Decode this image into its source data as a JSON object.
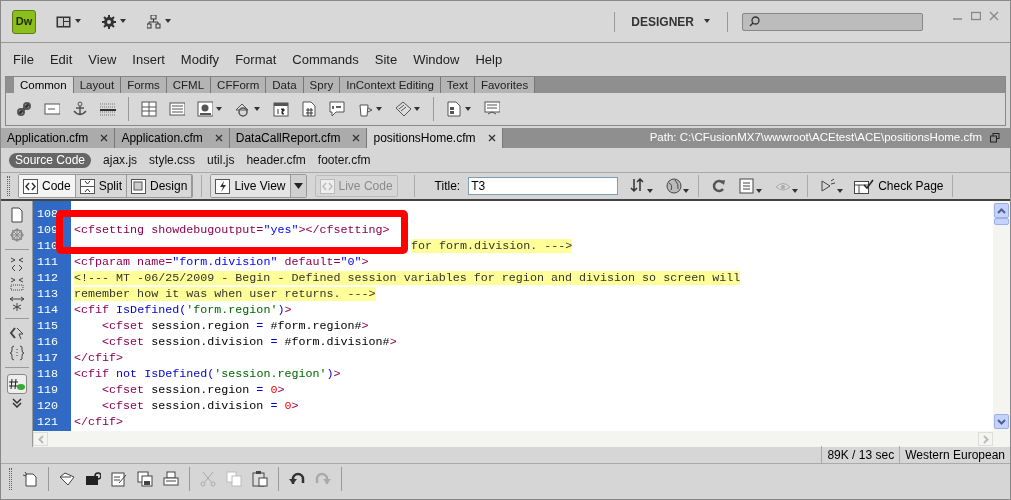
{
  "app_bar": {
    "logo": "Dw",
    "workspace": "DESIGNER"
  },
  "menu": [
    "File",
    "Edit",
    "View",
    "Insert",
    "Modify",
    "Format",
    "Commands",
    "Site",
    "Window",
    "Help"
  ],
  "insert_tabs": [
    {
      "label": "Common",
      "selected": true
    },
    {
      "label": "Layout",
      "selected": false
    },
    {
      "label": "Forms",
      "selected": false
    },
    {
      "label": "CFML",
      "selected": false
    },
    {
      "label": "CFForm",
      "selected": false
    },
    {
      "label": "Data",
      "selected": false
    },
    {
      "label": "Spry",
      "selected": false
    },
    {
      "label": "InContext Editing",
      "selected": false
    },
    {
      "label": "Text",
      "selected": false
    },
    {
      "label": "Favorites",
      "selected": false
    }
  ],
  "doc_tabs": [
    {
      "label": "Application.cfm",
      "selected": false
    },
    {
      "label": "Application.cfm",
      "selected": false
    },
    {
      "label": "DataCallReport.cfm",
      "selected": false
    },
    {
      "label": "positionsHome.cfm",
      "selected": true
    }
  ],
  "path": "Path:  C:\\CFusionMX7\\wwwroot\\ACEtest\\ACE\\positionsHome.cfm",
  "related_files": [
    {
      "label": "Source Code",
      "selected": true
    },
    {
      "label": "ajax.js",
      "selected": false
    },
    {
      "label": "style.css",
      "selected": false
    },
    {
      "label": "util.js",
      "selected": false
    },
    {
      "label": "header.cfm",
      "selected": false
    },
    {
      "label": "footer.cfm",
      "selected": false
    }
  ],
  "view_buttons": [
    {
      "label": "Code",
      "selected": true
    },
    {
      "label": "Split",
      "selected": false
    },
    {
      "label": "Design",
      "selected": false
    }
  ],
  "live_view": {
    "label": "Live View"
  },
  "live_code": {
    "label": "Live Code",
    "disabled": true
  },
  "title_field": {
    "label": "Title:",
    "value": "T3"
  },
  "check_page": "Check Page",
  "code_lines": [
    {
      "number": "108"
    },
    {
      "number": "109",
      "segments": [
        {
          "kind": "tag",
          "text": "<cfsetting showdebugoutput="
        },
        {
          "kind": "string",
          "text": "\"yes\""
        },
        {
          "kind": "tag",
          "text": "></cfsetting>"
        }
      ]
    },
    {
      "number": "110",
      "offset": true,
      "segments": [
        {
          "kind": "comment",
          "text": "for form.division. --->"
        }
      ]
    },
    {
      "number": "111",
      "segments": [
        {
          "kind": "tag",
          "text": "<cfparam name="
        },
        {
          "kind": "string",
          "text": "\"form.division\""
        },
        {
          "kind": "tag",
          "text": " default="
        },
        {
          "kind": "string",
          "text": "\"0\""
        },
        {
          "kind": "tag",
          "text": ">"
        }
      ]
    },
    {
      "number": "112",
      "segments": [
        {
          "kind": "comment",
          "text": "<!--- MT -06/25/2009 - Begin - Defined session variables for region and division so screen will"
        }
      ]
    },
    {
      "number": "113",
      "segments": [
        {
          "kind": "comment",
          "text": "remember how it was when user returns. --->"
        }
      ]
    },
    {
      "number": "114",
      "segments": [
        {
          "kind": "tag",
          "text": "<cfif "
        },
        {
          "kind": "function",
          "text": "IsDefined("
        },
        {
          "kind": "quoted",
          "text": "'form.region'"
        },
        {
          "kind": "function",
          "text": ")"
        },
        {
          "kind": "tag",
          "text": ">"
        }
      ]
    },
    {
      "number": "115",
      "segments": [
        {
          "kind": "tag",
          "text": "    <cfset"
        },
        {
          "kind": "plain",
          "text": " session.region "
        },
        {
          "kind": "function",
          "text": "="
        },
        {
          "kind": "plain",
          "text": " #form.region#"
        },
        {
          "kind": "tag",
          "text": ">"
        }
      ]
    },
    {
      "number": "116",
      "segments": [
        {
          "kind": "tag",
          "text": "    <cfset"
        },
        {
          "kind": "plain",
          "text": " session.division "
        },
        {
          "kind": "function",
          "text": "="
        },
        {
          "kind": "plain",
          "text": " #form.division#"
        },
        {
          "kind": "tag",
          "text": ">"
        }
      ]
    },
    {
      "number": "117",
      "segments": [
        {
          "kind": "tag",
          "text": "</cfif>"
        }
      ]
    },
    {
      "number": "118",
      "segments": [
        {
          "kind": "tag",
          "text": "<cfif "
        },
        {
          "kind": "function",
          "text": "not IsDefined("
        },
        {
          "kind": "quoted",
          "text": "'session.region'"
        },
        {
          "kind": "function",
          "text": ")"
        },
        {
          "kind": "tag",
          "text": ">"
        }
      ]
    },
    {
      "number": "119",
      "segments": [
        {
          "kind": "tag",
          "text": "    <cfset"
        },
        {
          "kind": "plain",
          "text": " session.region "
        },
        {
          "kind": "function",
          "text": "="
        },
        {
          "kind": "number",
          "text": " 0"
        },
        {
          "kind": "tag",
          "text": ">"
        }
      ]
    },
    {
      "number": "120",
      "segments": [
        {
          "kind": "tag",
          "text": "    <cfset"
        },
        {
          "kind": "plain",
          "text": " session.division "
        },
        {
          "kind": "function",
          "text": "="
        },
        {
          "kind": "number",
          "text": " 0"
        },
        {
          "kind": "tag",
          "text": ">"
        }
      ]
    },
    {
      "number": "121",
      "segments": [
        {
          "kind": "tag",
          "text": "</cfif>"
        }
      ]
    }
  ],
  "status_bar": [
    "89K / 13 sec",
    "Western European"
  ]
}
